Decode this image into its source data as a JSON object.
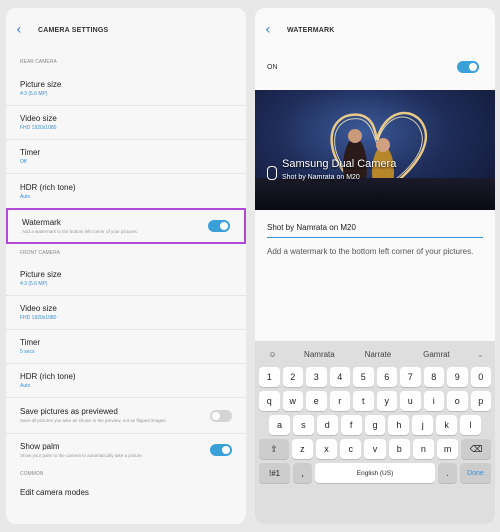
{
  "left": {
    "title": "CAMERA SETTINGS",
    "sections": {
      "rear": "REAR CAMERA",
      "front": "FRONT CAMERA",
      "common": "COMMON"
    },
    "rear_items": [
      {
        "title": "Picture size",
        "sub": "4:3 (5.6 MP)"
      },
      {
        "title": "Video size",
        "sub": "FHD 1920x1080"
      },
      {
        "title": "Timer",
        "sub": "Off"
      },
      {
        "title": "HDR (rich tone)",
        "sub": "Auto"
      }
    ],
    "watermark": {
      "title": "Watermark",
      "desc": "Add a watermark to the bottom left corner of your pictures.",
      "on": true
    },
    "front_items": [
      {
        "title": "Picture size",
        "sub": "4:3 (5.6 MP)"
      },
      {
        "title": "Video size",
        "sub": "FHD 1920x1080"
      },
      {
        "title": "Timer",
        "sub": "5 secs"
      },
      {
        "title": "HDR (rich tone)",
        "sub": "Auto"
      }
    ],
    "save_pictures": {
      "title": "Save pictures as previewed",
      "desc": "Save all pictures you take as shown in the preview, not as flipped images.",
      "on": false
    },
    "show_palm": {
      "title": "Show palm",
      "desc": "Show your palm to the camera to automatically take a picture.",
      "on": true
    },
    "edit_modes": "Edit camera modes"
  },
  "right": {
    "title": "WATERMARK",
    "on_label": "ON",
    "wm_brand": "Samsung Dual Camera",
    "wm_shot": "Shot by Namrata on M20",
    "input_value": "Shot by Namrata on M20",
    "help": "Add a watermark to the bottom left corner of your pictures."
  },
  "keyboard": {
    "suggestions": [
      "Namrata",
      "Narrate",
      "Gamrat"
    ],
    "row1": [
      "1",
      "2",
      "3",
      "4",
      "5",
      "6",
      "7",
      "8",
      "9",
      "0"
    ],
    "row2": [
      "q",
      "w",
      "e",
      "r",
      "t",
      "y",
      "u",
      "i",
      "o",
      "p"
    ],
    "row3": [
      "a",
      "s",
      "d",
      "f",
      "g",
      "h",
      "j",
      "k",
      "l"
    ],
    "row4": [
      "z",
      "x",
      "c",
      "v",
      "b",
      "n",
      "m"
    ],
    "sym": "!#1",
    "space": "English (US)",
    "period": ".",
    "done": "Done"
  },
  "colors": {
    "accent": "#3a8fd5",
    "highlight": "#b248d8"
  }
}
